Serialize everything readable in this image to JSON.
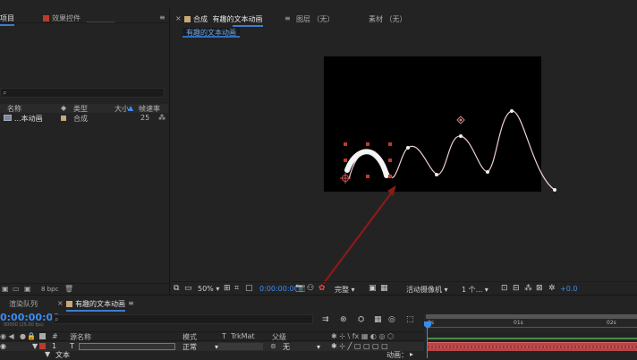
{
  "left_panel": {
    "tab_project": "项目",
    "tab_effects": "效果控件",
    "tab_effects_detail": "________",
    "search_placeholder": "",
    "columns": {
      "name": "名称",
      "type": "类型",
      "size": "大小",
      "framerate": "帧速率"
    },
    "items": [
      {
        "name": "...本动画",
        "type": "合成",
        "framerate": "25"
      }
    ],
    "bpc": "8 bpc"
  },
  "comp_panel": {
    "tab_prefix": "合成",
    "tab_name": "有趣的文本动画",
    "tab_layer": "图层 （无）",
    "tab_footage": "素材 （无）",
    "breadcrumb": "有趣的文本动画",
    "bg_color": "#000000",
    "path_color": "#f2d5d5",
    "handle_color": "#c0392b"
  },
  "viewer_toolbar": {
    "zoom": "50%",
    "timecode": "0:00:00:00",
    "resolution": "完整",
    "camera": "活动摄像机",
    "views": "1 个...",
    "exposure": "+0.0"
  },
  "timeline": {
    "tab_render_queue": "渲染队列",
    "tab_comp": "有趣的文本动画",
    "current_time": "0:00:00:00",
    "frame_info": "00000 (25.00 fps)",
    "search_placeholder": "",
    "col_num": "#",
    "col_source": "源名称",
    "col_mode": "模式",
    "col_t": "T",
    "col_trkmat": "TrkMat",
    "col_parent": "父级",
    "layer": {
      "num": "1",
      "type_icon": "T",
      "mode": "正常",
      "parent": "无"
    },
    "sublayer": "文本",
    "animate_label": "动画：",
    "ruler": [
      "0s",
      "01s",
      "02s"
    ],
    "layer_bar_color": "#c14848"
  }
}
